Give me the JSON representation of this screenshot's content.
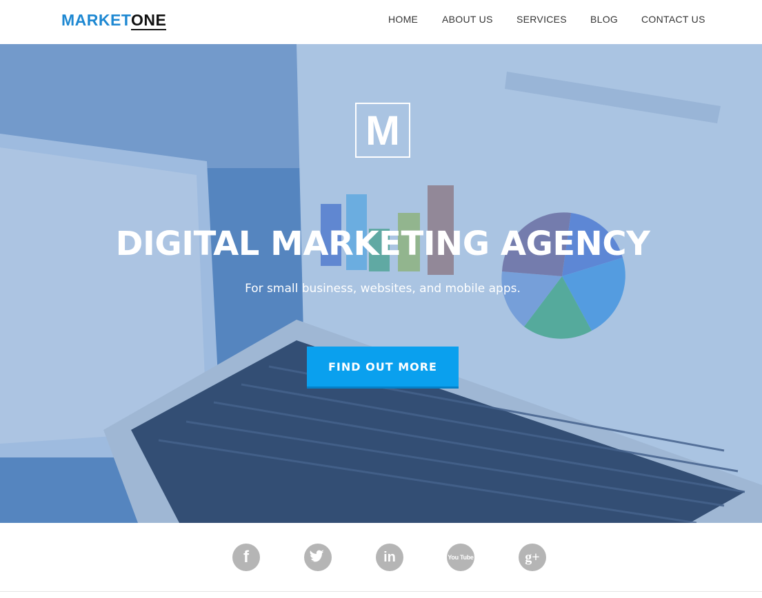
{
  "brand": {
    "part1": "MARKET",
    "part2": "ONE"
  },
  "nav": {
    "items": [
      {
        "label": "HOME"
      },
      {
        "label": "ABOUT US"
      },
      {
        "label": "SERVICES"
      },
      {
        "label": "BLOG"
      },
      {
        "label": "CONTACT US"
      }
    ]
  },
  "hero": {
    "badge_letter": "M",
    "title": "DIGITAL MARKETING AGENCY",
    "subtitle": "For small business, websites, and mobile apps.",
    "cta_label": "FIND OUT MORE"
  },
  "social": {
    "icons": [
      {
        "name": "facebook-icon",
        "glyph": "f"
      },
      {
        "name": "twitter-icon",
        "glyph": "t"
      },
      {
        "name": "linkedin-icon",
        "glyph": "in"
      },
      {
        "name": "youtube-icon",
        "glyph": "You Tube"
      },
      {
        "name": "google-plus-icon",
        "glyph": "g+"
      }
    ]
  },
  "colors": {
    "brand_blue": "#1e88d2",
    "hero_tint": "#3e78be",
    "cta_blue": "#0aa0ee",
    "social_gray": "#b5b5b5"
  }
}
